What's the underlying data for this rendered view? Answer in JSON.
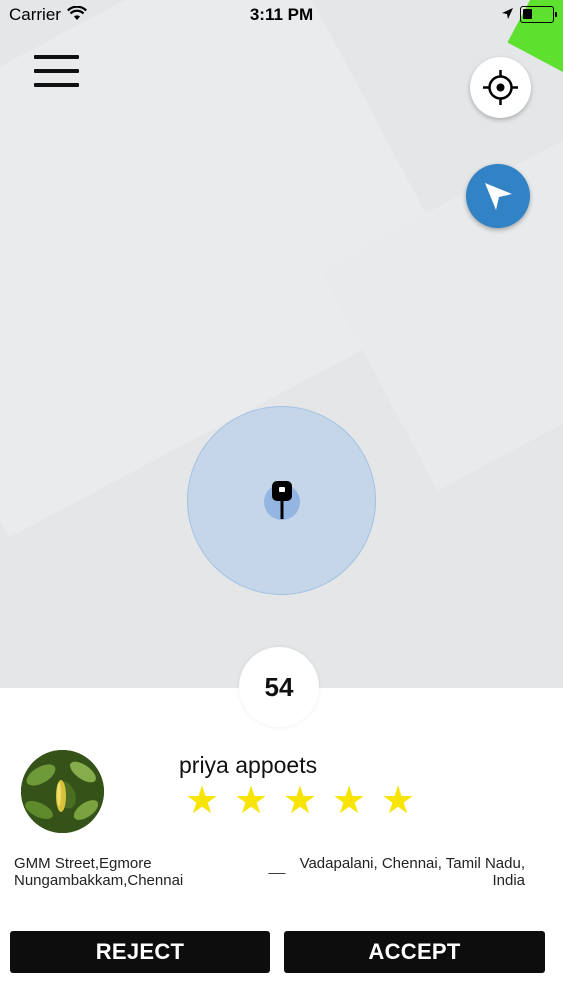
{
  "status_bar": {
    "carrier": "Carrier",
    "time": "3:11 PM",
    "icons": [
      "wifi-icon",
      "location-arrow-icon",
      "battery-icon"
    ]
  },
  "map": {
    "controls": [
      "menu-icon",
      "crosshair-icon",
      "navigation-arrow-icon"
    ],
    "marker": "car-pin-icon",
    "accent_color": "#3282c6"
  },
  "trip_request": {
    "countdown": "54",
    "rider_name": "priya appoets",
    "rating": 5,
    "star_glyph": "★",
    "star_color": "#f7e400",
    "pickup": {
      "line1": "GMM Street,Egmore",
      "line2": "Nungambakkam,Chennai"
    },
    "separator": "__",
    "drop": {
      "line1": "Vadapalani, Chennai, Tamil Nadu,",
      "line2": "India"
    },
    "actions": {
      "reject_label": "REJECT",
      "accept_label": "ACCEPT"
    }
  }
}
